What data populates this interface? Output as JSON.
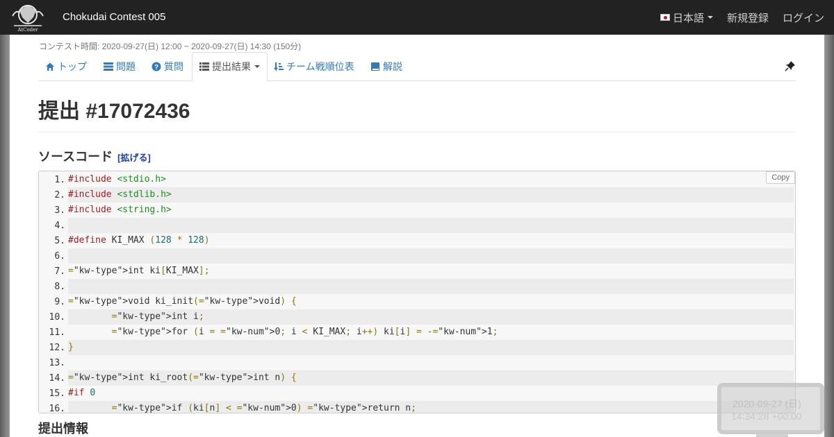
{
  "navbar": {
    "brand": "Chokudai Contest 005",
    "language": "日本語",
    "signup": "新規登録",
    "login": "ログイン",
    "logo_text": "AtCoder"
  },
  "contest_time": "コンテスト時間: 2020-09-27(日) 12:00 ~ 2020-09-27(日) 14:30 (150分)",
  "tabs": [
    {
      "label": "トップ",
      "icon": "home-icon"
    },
    {
      "label": "問題",
      "icon": "list-icon"
    },
    {
      "label": "質問",
      "icon": "question-icon"
    },
    {
      "label": "提出結果",
      "icon": "list-icon"
    },
    {
      "label": "チーム戦順位表",
      "icon": "sort-icon"
    },
    {
      "label": "解説",
      "icon": "book-icon"
    }
  ],
  "page_title": "提出 #17072436",
  "source_section": {
    "title": "ソースコード",
    "expand": "[拡げる]",
    "copy": "Copy"
  },
  "code_lines": [
    "#include <stdio.h>",
    "#include <stdlib.h>",
    "#include <string.h>",
    "",
    "#define KI_MAX (128 * 128)",
    "",
    "int ki[KI_MAX];",
    "",
    "void ki_init(void) {",
    "\tint i;",
    "\tfor (i = 0; i < KI_MAX; i++) ki[i] = -1;",
    "}",
    "",
    "int ki_root(int n) {",
    "#if 0",
    "\tif (ki[n] < 0) return n;"
  ],
  "submission_info_title": "提出情報",
  "clock": {
    "date": "2020-09-27 (日)",
    "time": "14:34:28 +00:00"
  },
  "colors": {
    "navbar": "#222222",
    "link": "#337ab7",
    "preprocessor": "#9b1c1c",
    "string": "#1a8f1a",
    "type": "#1b1b8f"
  }
}
